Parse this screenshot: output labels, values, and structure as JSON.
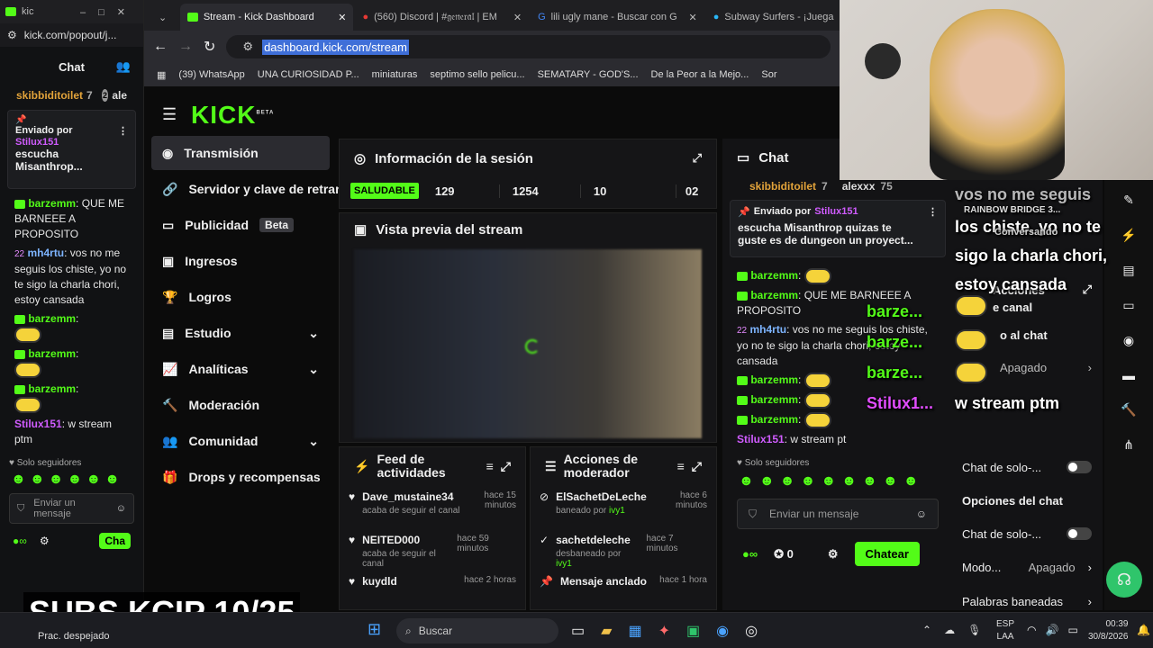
{
  "popout": {
    "window_title": "kic",
    "url": "kick.com/popout/j...",
    "chat_title": "Chat",
    "top_users": [
      "skibbiditoilet",
      "7",
      "2",
      "ale"
    ],
    "pinned": {
      "label": "Enviado por",
      "user": "Stilux151",
      "text": "escucha Misanthrop..."
    },
    "messages": [
      {
        "user": "barzemm",
        "text": ": QUE ME BARNEEE A PROPOSITO"
      },
      {
        "badge": "22",
        "user": "mh4rtu",
        "text": ": vos no me seguis los chiste, yo no te sigo la charla chori, estoy cansada"
      },
      {
        "user": "barzemm",
        "text": ":"
      },
      {
        "user": "barzemm",
        "text": ":"
      },
      {
        "user": "barzemm",
        "text": ":"
      },
      {
        "user": "Stilux151",
        "text": ": w stream ptm"
      }
    ],
    "followers_only": "Solo seguidores",
    "input_placeholder": "Enviar un mensaje",
    "send_btn": "Cha"
  },
  "tabs": [
    {
      "label": "Stream - Kick Dashboard",
      "active": true
    },
    {
      "label": "(560) Discord | #𝔤𝔢𝔫𝔢𝔯𝔞𝔩 | EM",
      "active": false
    },
    {
      "label": "lili ugly mane - Buscar con G",
      "active": false
    },
    {
      "label": "Subway Surfers - ¡Juega",
      "active": false
    }
  ],
  "address": "dashboard.kick.com/stream",
  "bookmarks": [
    "(39) WhatsApp",
    "UNA CURIOSIDAD P...",
    "miniaturas",
    "septimo sello pelicu...",
    "SEMATARY - GOD'S...",
    "De la Peor a la Mejo...",
    "Sor"
  ],
  "logo": "KICK",
  "logo_beta": "BETA",
  "sidebar": {
    "items": [
      {
        "label": "Transmisión",
        "active": true
      },
      {
        "label": "Servidor y clave de retransmisión"
      },
      {
        "label": "Publicidad",
        "tag": "Beta"
      },
      {
        "label": "Ingresos"
      },
      {
        "label": "Logros"
      },
      {
        "label": "Estudio",
        "chevron": true
      },
      {
        "label": "Analíticas",
        "chevron": true
      },
      {
        "label": "Moderación"
      },
      {
        "label": "Comunidad",
        "chevron": true
      },
      {
        "label": "Drops y recompensas"
      }
    ]
  },
  "session": {
    "title": "Información de la sesión",
    "status": "SALUDABLE",
    "stats": [
      "129",
      "1254",
      "10",
      "02"
    ]
  },
  "preview": {
    "title": "Vista previa del stream",
    "subs_overlay": "SUBS KCIP 10/25"
  },
  "feed": {
    "title": "Feed de actividades",
    "items": [
      {
        "user": "Dave_mustaine34",
        "sub": "acaba de seguir el canal",
        "time": "hace 15 minutos"
      },
      {
        "user": "NEITED000",
        "sub": "acaba de seguir el canal",
        "time": "hace 59 minutos"
      },
      {
        "user": "kuydld",
        "sub": "",
        "time": "hace 2 horas"
      }
    ]
  },
  "modactions": {
    "title": "Acciones de moderador",
    "items": [
      {
        "user": "ElSachetDeLeche",
        "sub_pre": "baneado por",
        "by": "ivy1",
        "time": "hace 6 minutos"
      },
      {
        "user": "sachetdeleche",
        "sub_pre": "desbaneado por",
        "by": "ivy1",
        "time": "hace 7 minutos"
      },
      {
        "user": "Mensaje anclado",
        "sub_pre": "",
        "by": "",
        "time": "hace 1 hora"
      }
    ]
  },
  "chat": {
    "title": "Chat",
    "top_users": [
      "skibbiditoilet",
      "7",
      "alexxx",
      "75"
    ],
    "pinned_label": "Enviado por",
    "pinned_user": "Stilux151",
    "pinned_text": "escucha Misanthrop quizas te guste es de dungeon un proyect...",
    "messages": [
      {
        "user": "barzemm",
        "text": ":"
      },
      {
        "user": "barzemm",
        "text": ": QUE ME BARNEEE A PROPOSITO"
      },
      {
        "badge": "22",
        "user": "mh4rtu",
        "text": ": vos no me seguis los chiste, yo no te sigo la charla chori, estoy cansada"
      },
      {
        "user": "barzemm",
        "text": ":"
      },
      {
        "user": "barzemm",
        "text": ":"
      },
      {
        "user": "barzemm",
        "text": ":"
      },
      {
        "user": "Stilux151",
        "text": ": w stream pt"
      }
    ],
    "followers_only": "Solo seguidores",
    "input_placeholder": "Enviar un mensaje",
    "viewers": "0",
    "send_btn": "Chatear"
  },
  "overlay": {
    "big_msg": "los chiste, yo no te sigo la charla chori, estoy cansada",
    "big_msg_top": "vos no me seguis",
    "names": [
      "barze...",
      "barze...",
      "barze...",
      "Stilux1..."
    ],
    "wstream": "w stream ptm",
    "rainbow": "RAINBOW BRIDGE 3...",
    "conversando": "Conversando"
  },
  "settings": {
    "acciones": "Acciones",
    "canal": "e canal",
    "al_chat": "o al chat",
    "apagado": "Apagado",
    "solo_1": "Chat de solo-...",
    "opciones": "Opciones del chat",
    "solo_2": "Chat de solo-...",
    "modo": "Modo...",
    "apagado2": "Apagado",
    "palabras": "Palabras baneadas"
  },
  "taskbar": {
    "weather": "Prac. despejado",
    "search": "Buscar",
    "lang1": "ESP",
    "lang2": "LAA",
    "time": "00:39",
    "date": "30/8/2026"
  }
}
